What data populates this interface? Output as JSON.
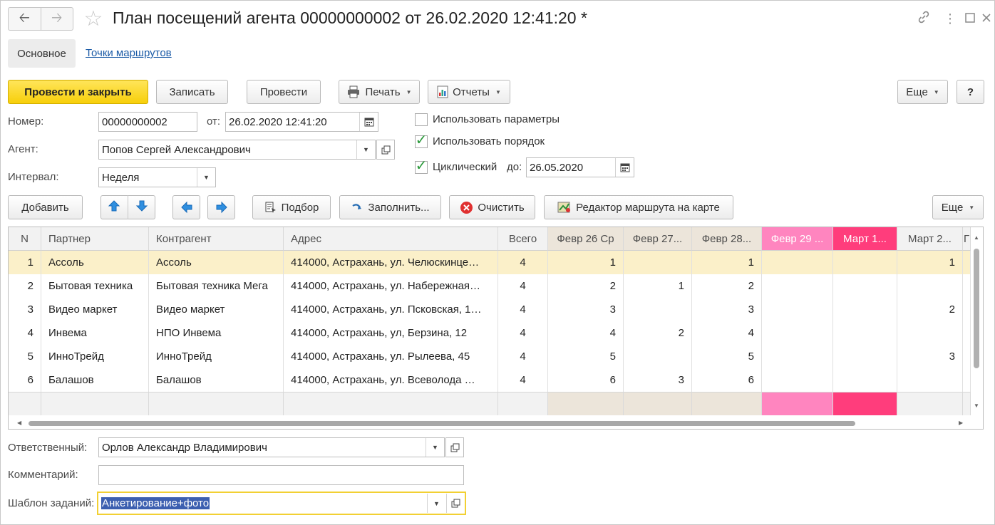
{
  "window": {
    "title": "План посещений агента 00000000002 от 26.02.2020 12:41:20 *",
    "icons": [
      "link-icon",
      "more-vertical-icon",
      "maximize-icon",
      "close-icon"
    ]
  },
  "tabs": {
    "main": "Основное",
    "route_points": "Точки маршрутов"
  },
  "toolbar": {
    "post_close": "Провести и закрыть",
    "save": "Записать",
    "post": "Провести",
    "print": "Печать",
    "reports": "Отчеты",
    "more": "Еще",
    "help": "?"
  },
  "form": {
    "number_label": "Номер:",
    "number_value": "00000000002",
    "date_label": "от:",
    "date_value": "26.02.2020 12:41:20",
    "agent_label": "Агент:",
    "agent_value": "Попов Сергей Александрович",
    "interval_label": "Интервал:",
    "interval_value": "Неделя",
    "use_params": {
      "label": "Использовать параметры",
      "checked": false
    },
    "use_order": {
      "label": "Использовать порядок",
      "checked": true
    },
    "cyclic": {
      "label": "Циклический",
      "checked": true
    },
    "until_label": "до:",
    "until_value": "26.05.2020"
  },
  "table_toolbar": {
    "add": "Добавить",
    "pick": "Подбор",
    "fill": "Заполнить...",
    "clear": "Очистить",
    "map_editor": "Редактор маршрута на карте",
    "more": "Еще"
  },
  "table": {
    "headers": [
      "N",
      "Партнер",
      "Контрагент",
      "Адрес",
      "Всего",
      "Февр 26 Ср",
      "Февр 27...",
      "Февр 28...",
      "Февр 29 ...",
      "Март 1...",
      "Март 2...",
      "Г"
    ],
    "rows": [
      [
        "1",
        "Ассоль",
        "Ассоль",
        "414000, Астрахань, ул. Челюскинце…",
        "4",
        "1",
        "",
        "1",
        "",
        "",
        "1"
      ],
      [
        "2",
        "Бытовая техника",
        "Бытовая техника Мега",
        "414000, Астрахань, ул. Набережная…",
        "4",
        "2",
        "1",
        "2",
        "",
        "",
        ""
      ],
      [
        "3",
        "Видео маркет",
        "Видео маркет",
        "414000, Астрахань, ул. Псковская, 1…",
        "4",
        "3",
        "",
        "3",
        "",
        "",
        "2"
      ],
      [
        "4",
        "Инвема",
        "НПО Инвема",
        "414000, Астрахань, ул, Берзина, 12",
        "4",
        "4",
        "2",
        "4",
        "",
        "",
        ""
      ],
      [
        "5",
        "ИнноТрейд",
        "ИнноТрейд",
        "414000, Астрахань, ул. Рылеева, 45",
        "4",
        "5",
        "",
        "5",
        "",
        "",
        "3"
      ],
      [
        "6",
        "Балашов",
        "Балашов",
        "414000, Астрахань, ул. Всеволода …",
        "4",
        "6",
        "3",
        "6",
        "",
        "",
        ""
      ]
    ],
    "selected_row": 0
  },
  "bottom": {
    "responsible_label": "Ответственный:",
    "responsible_value": "Орлов Александр Владимирович",
    "comment_label": "Комментарий:",
    "comment_value": "",
    "template_label": "Шаблон заданий:",
    "template_value": "Анкетирование+фото"
  },
  "colors": {
    "primary_button": "#f7cf0a",
    "selected_row": "#fbf0c9",
    "weekday_header": "#ece5da",
    "saturday_header": "#ff85bf",
    "sunday_header": "#ff3d7c",
    "link": "#1a5aa6",
    "check": "#2b9a3b"
  }
}
